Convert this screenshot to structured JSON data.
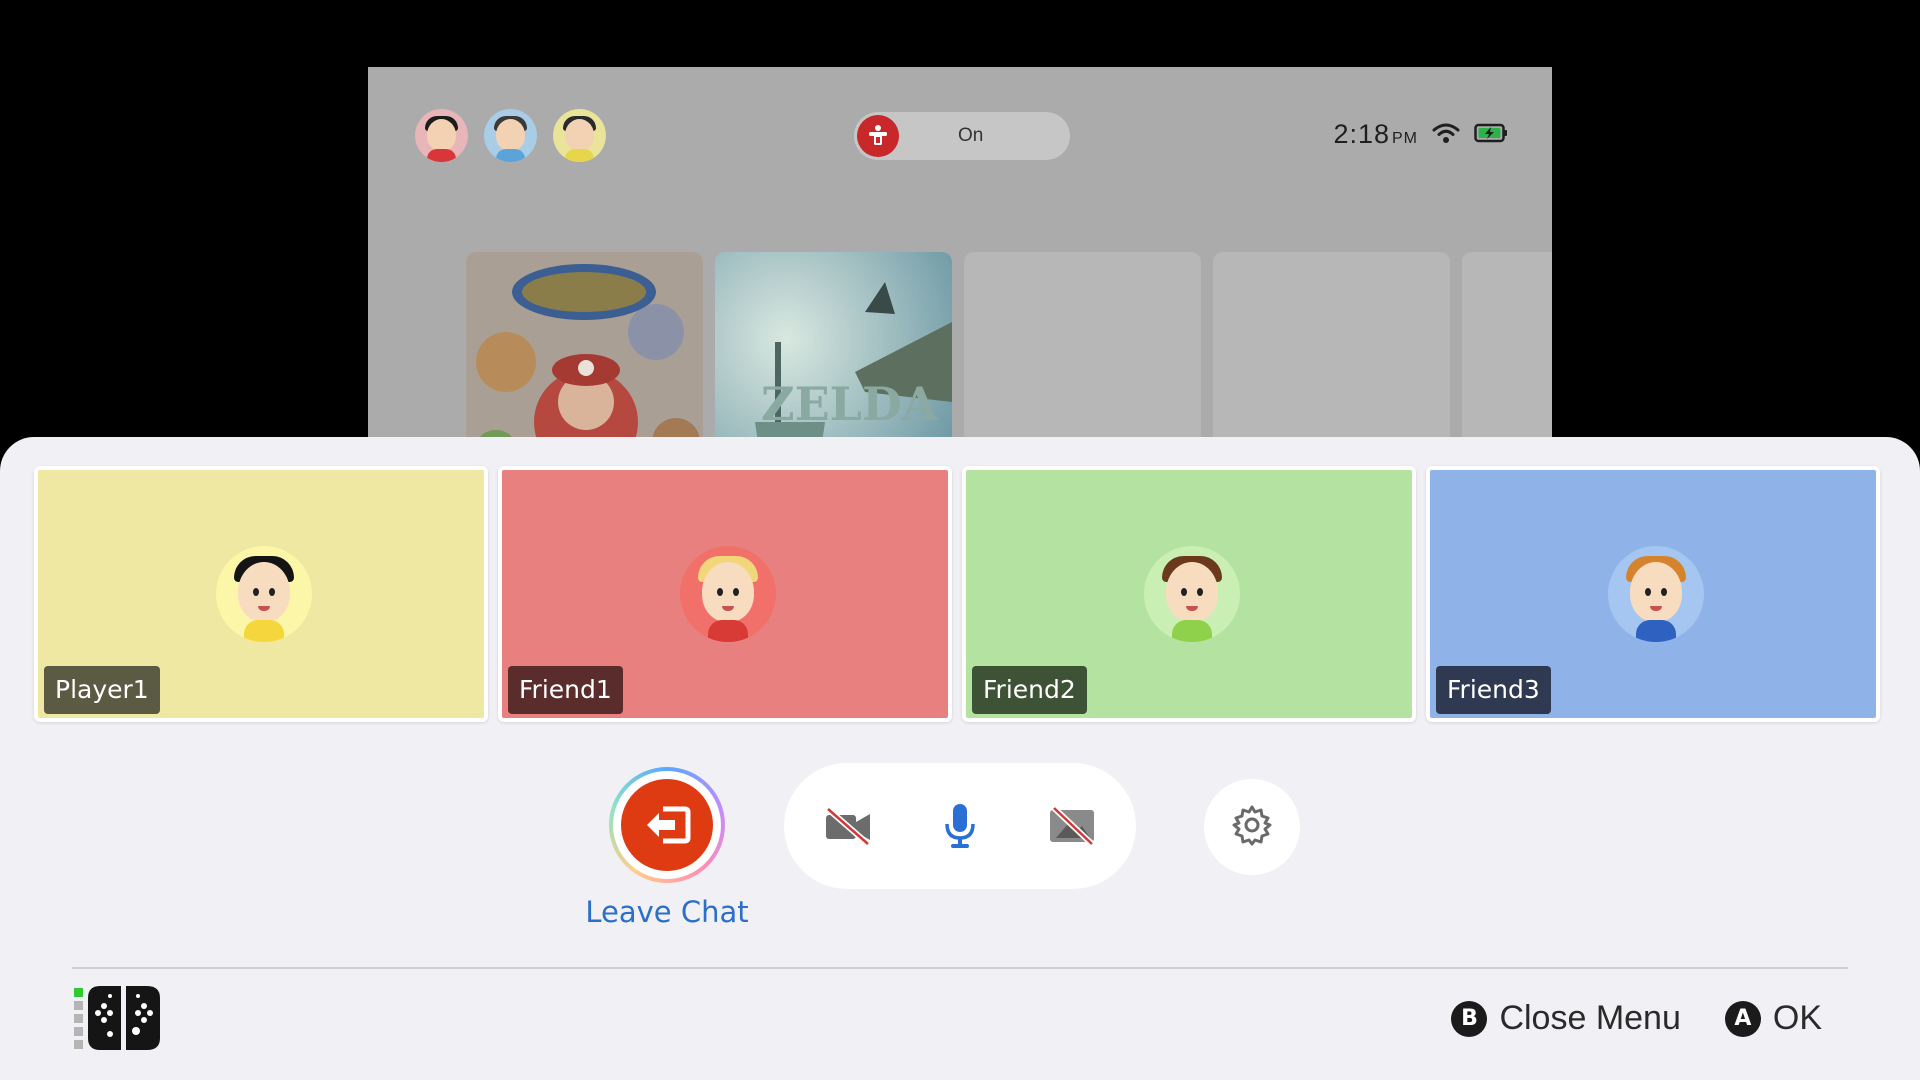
{
  "home": {
    "user_avatars": [
      {
        "name": "user-1",
        "bg": "#e8b5b8",
        "hair": "#1c1c1c",
        "body": "#d8363a"
      },
      {
        "name": "user-2",
        "bg": "#a9cde6",
        "hair": "#3a3a3a",
        "body": "#5aa4d9"
      },
      {
        "name": "user-3",
        "bg": "#eae39a",
        "hair": "#2a2a2a",
        "body": "#e7d64a"
      }
    ],
    "parental_controls": {
      "status": "On",
      "icon": "parental-controls-icon"
    },
    "clock": {
      "time": "2:18",
      "ampm": "PM"
    },
    "status_icons": [
      "wifi-icon",
      "battery-charging-icon"
    ],
    "games": [
      {
        "name": "mariokart-world",
        "colors": [
          "#3a7fd0",
          "#e0413a",
          "#f4c542"
        ]
      },
      {
        "name": "zelda-tears-of-the-kingdom",
        "colors": [
          "#74b6d6",
          "#c9e4ee",
          "#3a7d6a"
        ]
      }
    ]
  },
  "chat": {
    "participants": [
      {
        "name": "Player1",
        "card_color": "#efe8a2",
        "tag_color": "#5b5a43",
        "avatar_bg": "#fbf6a8",
        "hair": "#141414",
        "body": "#f5d63c"
      },
      {
        "name": "Friend1",
        "card_color": "#e7807e",
        "tag_color": "#5a2c2c",
        "avatar_bg": "#f2706a",
        "hair": "#f2d67a",
        "body": "#d83a36"
      },
      {
        "name": "Friend2",
        "card_color": "#b4e2a0",
        "tag_color": "#3e5236",
        "avatar_bg": "#c9efb5",
        "hair": "#6b3a1c",
        "body": "#8fd14a"
      },
      {
        "name": "Friend3",
        "card_color": "#8fb2e8",
        "tag_color": "#2f3a52",
        "avatar_bg": "#a6c6f2",
        "hair": "#d6832e",
        "body": "#2f62c0"
      }
    ],
    "leave_label": "Leave Chat",
    "controls": {
      "camera": "camera-off-icon",
      "mic": "microphone-icon",
      "screen_share": "screen-share-off-icon",
      "settings": "gear-icon"
    }
  },
  "footer": {
    "close_key": "B",
    "close_label": "Close Menu",
    "ok_key": "A",
    "ok_label": "OK"
  },
  "colors": {
    "accent_blue": "#2b6fc8",
    "leave_red": "#df3b12",
    "mic_blue": "#2a6fd6",
    "controller_led": "#32c832"
  }
}
